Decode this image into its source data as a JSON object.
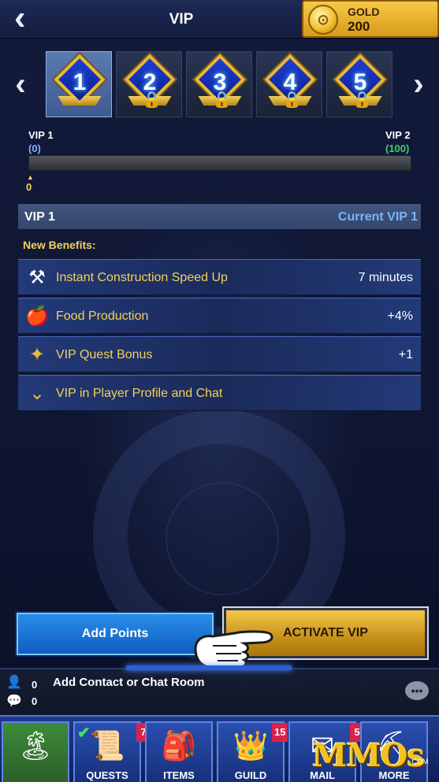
{
  "header": {
    "back_icon": "back-arrow-icon",
    "title": "VIP",
    "gold": {
      "label": "GOLD",
      "value": "200",
      "icon": "gold-coin-icon"
    }
  },
  "tiers": [
    {
      "number": "1",
      "locked": false,
      "selected": true
    },
    {
      "number": "2",
      "locked": true,
      "selected": false
    },
    {
      "number": "3",
      "locked": true,
      "selected": false
    },
    {
      "number": "4",
      "locked": true,
      "selected": false
    },
    {
      "number": "5",
      "locked": true,
      "selected": false
    }
  ],
  "progress": {
    "from_label": "VIP 1",
    "from_points": "(0)",
    "to_label": "VIP 2",
    "to_points": "(100)",
    "current_value": "0",
    "fraction": 0.0
  },
  "section": {
    "title": "VIP 1",
    "status": "Current VIP 1",
    "benefits_title": "New Benefits:"
  },
  "benefits": [
    {
      "icon": "hammer-icon",
      "label": "Instant Construction Speed Up",
      "value": "7 minutes"
    },
    {
      "icon": "apple-icon",
      "label": "Food Production",
      "value": "+4%"
    },
    {
      "icon": "vip-emblem-icon",
      "label": "VIP Quest Bonus",
      "value": "+1"
    },
    {
      "icon": "vip-chevron-icon",
      "label": "VIP in Player Profile and Chat",
      "value": ""
    }
  ],
  "actions": {
    "add_points": "Add Points",
    "activate_vip": "ACTIVATE VIP"
  },
  "chat": {
    "contacts_count": "0",
    "messages_count": "0",
    "prompt": "Add Contact or Chat Room"
  },
  "nav": [
    {
      "id": "home",
      "label": "",
      "icon": "castle-island-icon",
      "badge": ""
    },
    {
      "id": "quests",
      "label": "QUESTS",
      "icon": "quest-scroll-icon",
      "badge": "7"
    },
    {
      "id": "items",
      "label": "ITEMS",
      "icon": "backpack-icon",
      "badge": ""
    },
    {
      "id": "guild",
      "label": "GUILD",
      "icon": "crown-icon",
      "badge": "15"
    },
    {
      "id": "mail",
      "label": "MAIL",
      "icon": "winged-letter-icon",
      "badge": "5"
    },
    {
      "id": "more",
      "label": "MORE",
      "icon": "pickaxe-icon",
      "badge": ""
    }
  ],
  "watermark": {
    "text": "MMOs",
    "suffix": ".COM"
  },
  "colors": {
    "gold_accent": "#f5d05a",
    "current_vip_blue": "#76b5ff",
    "to_points_green": "#39d36b",
    "badge_red": "#d8234a"
  }
}
